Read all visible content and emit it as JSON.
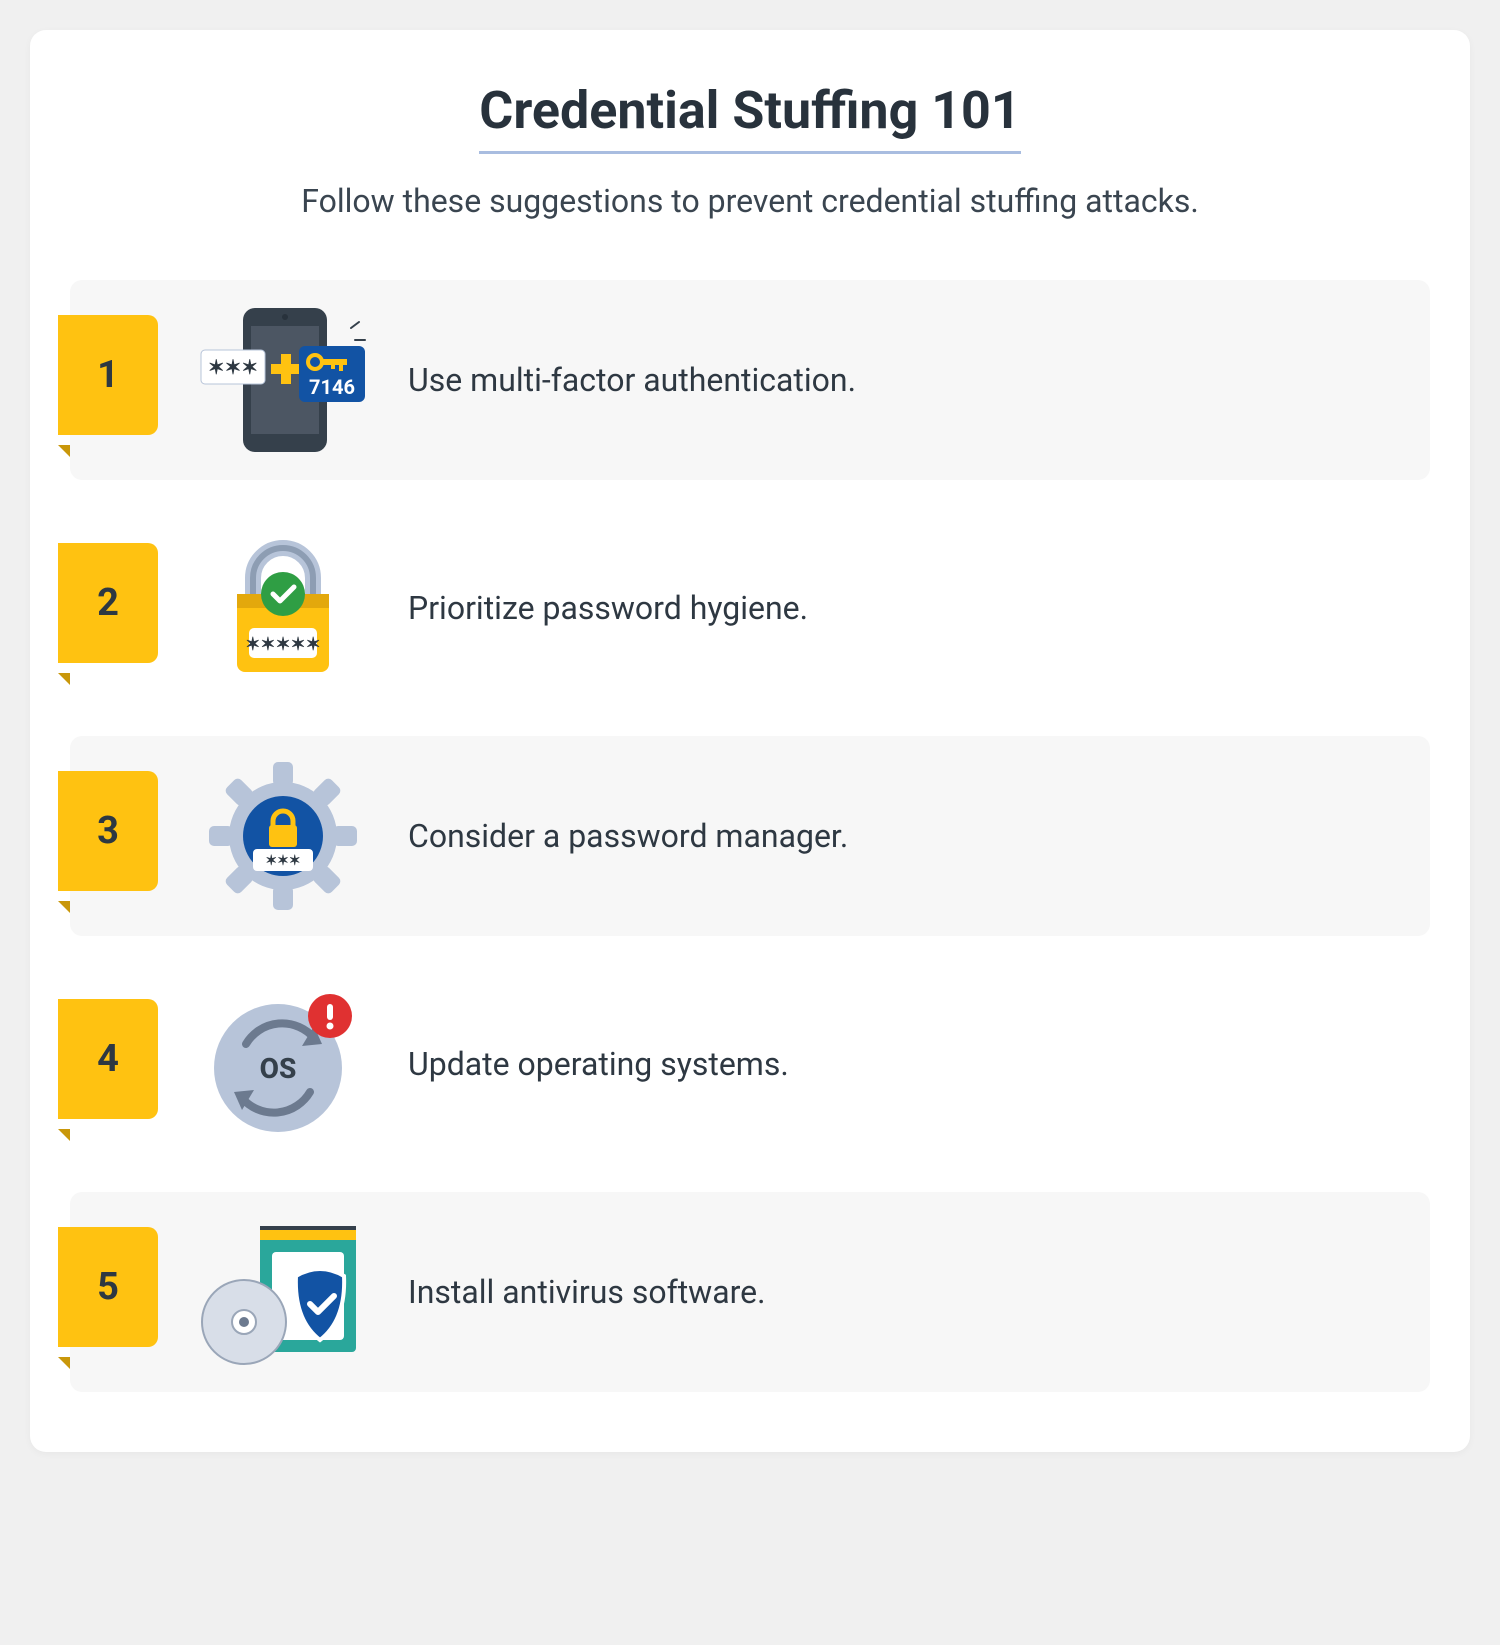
{
  "title": "Credential Stuffing 101",
  "subtitle": "Follow these suggestions to prevent credential stuffing attacks.",
  "tips": [
    {
      "num": "1",
      "text": "Use multi-factor authentication.",
      "icon": "mfa-phone-icon"
    },
    {
      "num": "2",
      "text": "Prioritize password hygiene.",
      "icon": "padlock-check-icon"
    },
    {
      "num": "3",
      "text": "Consider a password manager.",
      "icon": "gear-lock-icon"
    },
    {
      "num": "4",
      "text": "Update operating systems.",
      "icon": "os-update-icon"
    },
    {
      "num": "5",
      "text": "Install antivirus software.",
      "icon": "antivirus-shield-icon"
    }
  ],
  "colors": {
    "accent": "#ffc211",
    "accent_dark": "#c9970a",
    "blue": "#1253a4",
    "green": "#2f9e44",
    "red": "#e03131",
    "teal": "#2aa79b",
    "gray_light": "#b7c4d9",
    "dark": "#35404b"
  }
}
